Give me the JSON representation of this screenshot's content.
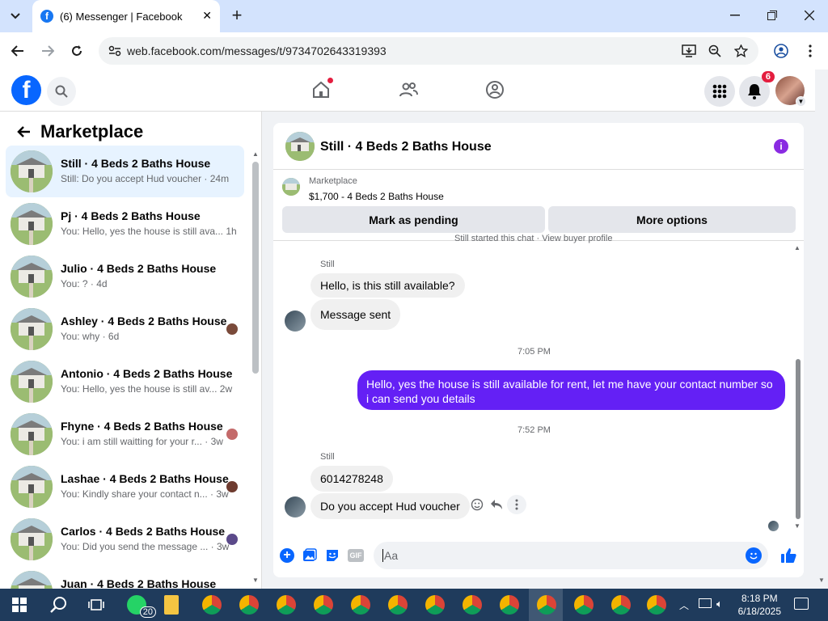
{
  "browser": {
    "tab_title": "(6) Messenger | Facebook",
    "url": "web.facebook.com/messages/t/9734702643319393",
    "favicon_letter": "f"
  },
  "fb": {
    "notif_count": "6"
  },
  "left": {
    "title": "Marketplace",
    "items": [
      {
        "name": "Still · 4 Beds 2 Baths House",
        "snippet": "Still: Do you accept Hud voucher · 24m",
        "active": true
      },
      {
        "name": "Pj · 4 Beds 2 Baths House",
        "snippet": "You: Hello, yes the house is still ava...   1h"
      },
      {
        "name": "Julio · 4 Beds 2 Baths House",
        "snippet": "You: ? · 4d"
      },
      {
        "name": "Ashley · 4 Beds 2 Baths House",
        "snippet": "You: why · 6d"
      },
      {
        "name": "Antonio · 4 Beds 2 Baths House",
        "snippet": "You: Hello, yes the house is still av...   2w"
      },
      {
        "name": "Fhyne · 4 Beds 2 Baths House",
        "snippet": "You: i am still waitting for your r... · 3w"
      },
      {
        "name": "Lashae · 4 Beds 2 Baths House",
        "snippet": "You: Kindly share your contact n... · 3w"
      },
      {
        "name": "Carlos · 4 Beds 2 Baths House",
        "snippet": "You: Did you send the message ... · 3w"
      },
      {
        "name": "Juan · 4 Beds 2 Baths House",
        "snippet": ""
      }
    ]
  },
  "chat": {
    "title": "Still · 4 Beds 2 Baths House",
    "listing_source": "Marketplace",
    "listing": "$1,700 - 4 Beds 2 Baths House",
    "mark_pending": "Mark as pending",
    "more_options": "More options",
    "top_note": "Still started this chat · View buyer profile",
    "messages": {
      "sender1": "Still",
      "m1": "Hello, is this still available?",
      "m2": "Message sent",
      "time1": "7:05 PM",
      "m3": "Hello, yes the house is still available for rent, let me have your contact number so i can send you  details",
      "time2": "7:52 PM",
      "sender2": "Still",
      "m4": "6014278248",
      "m5": "Do you accept Hud voucher"
    },
    "compose_placeholder": "Aa",
    "gif_label": "GIF"
  },
  "taskbar": {
    "time": "8:18 PM",
    "date": "6/18/2025",
    "whatsapp_badge": "20"
  }
}
